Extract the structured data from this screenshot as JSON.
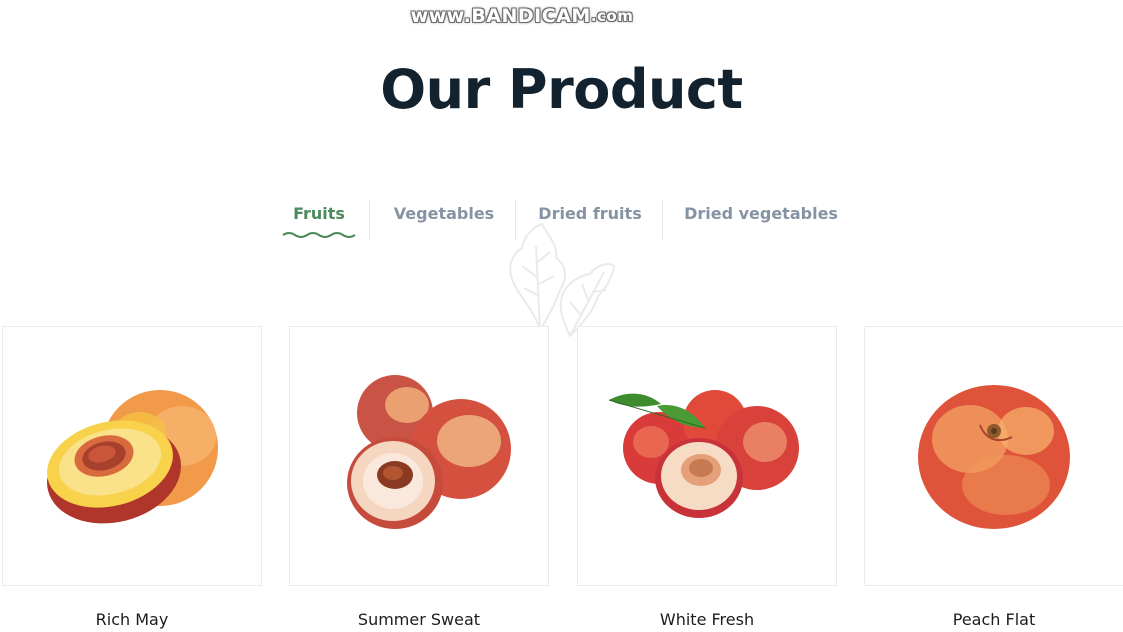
{
  "watermark": {
    "main": "www.BANDICAM",
    "tld": ".com"
  },
  "header": {
    "title": "Our Product"
  },
  "tabs": [
    {
      "label": "Fruits",
      "active": true
    },
    {
      "label": "Vegetables",
      "active": false
    },
    {
      "label": "Dried fruits",
      "active": false
    },
    {
      "label": "Dried vegetables",
      "active": false
    }
  ],
  "products": [
    {
      "name": "Rich May",
      "image": "peach-half-icon"
    },
    {
      "name": "Summer Sweat",
      "image": "peach-trio-icon"
    },
    {
      "name": "White Fresh",
      "image": "nectarine-leaf-icon"
    },
    {
      "name": "Peach Flat",
      "image": "flat-peach-icon"
    }
  ],
  "colors": {
    "accent": "#4c8a5b",
    "title": "#13222f",
    "tab_inactive": "#8593a3"
  }
}
